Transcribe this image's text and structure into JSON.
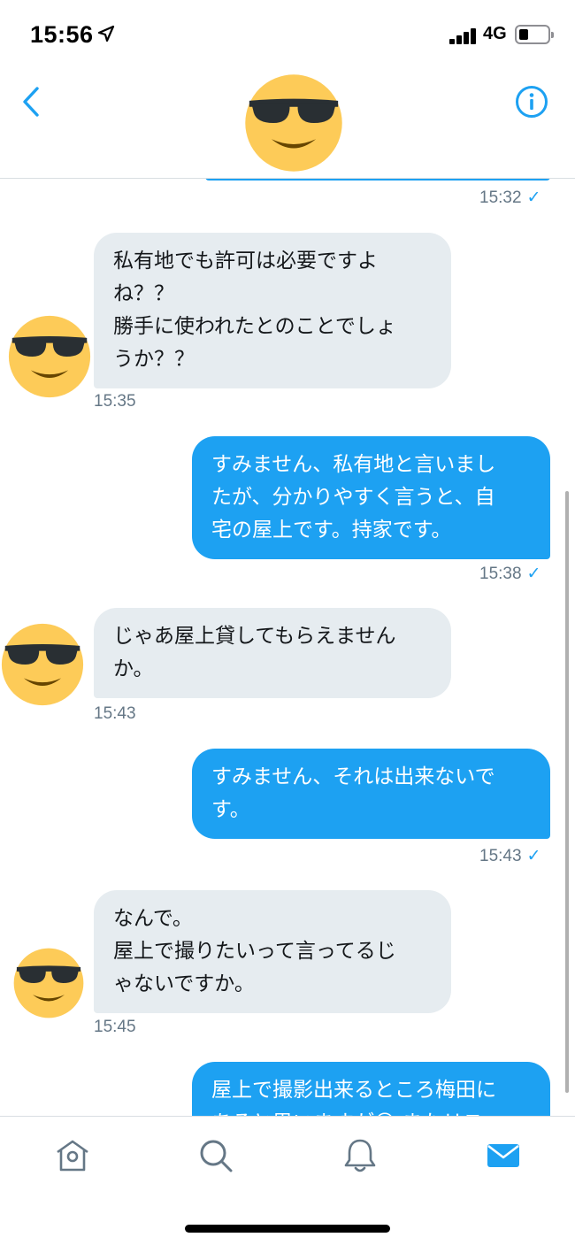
{
  "status_bar": {
    "time": "15:56",
    "network": "4G"
  },
  "header": {
    "back_icon": "chevron-left-icon",
    "info_icon": "info-circle-icon",
    "avatar_icon": "sunglasses-smiley-icon"
  },
  "messages": [
    {
      "direction": "out",
      "lines": [],
      "time": "15:32",
      "read": true
    },
    {
      "direction": "in",
      "lines": [
        "私有地でも許可は必要ですよ",
        "ね？？",
        "勝手に使われたとのことでしょ",
        "うか？？"
      ],
      "time": "15:35"
    },
    {
      "direction": "out",
      "lines": [
        "すみません、私有地と言いまし",
        "たが、分かりやすく言うと、自",
        "宅の屋上です。持家です。"
      ],
      "time": "15:38",
      "read": true
    },
    {
      "direction": "in",
      "lines": [
        "じゃあ屋上貸してもらえません",
        "か。"
      ],
      "time": "15:43"
    },
    {
      "direction": "out",
      "lines": [
        "すみません、それは出来ないで",
        "す。"
      ],
      "time": "15:43",
      "read": true
    },
    {
      "direction": "in",
      "lines": [
        "なんで。",
        "屋上で撮りたいって言ってるじ",
        "ゃないですか。"
      ],
      "time": "15:45"
    },
    {
      "direction": "out",
      "lines": [
        "屋上で撮影出来るところ梅田に",
        "あると思いますが😅 またリス"
      ],
      "time": ""
    }
  ],
  "read_mark": "✓",
  "tabs": [
    {
      "name": "home",
      "icon": "home-icon",
      "active": false
    },
    {
      "name": "search",
      "icon": "search-icon",
      "active": false
    },
    {
      "name": "notifications",
      "icon": "bell-icon",
      "active": false
    },
    {
      "name": "messages",
      "icon": "mail-icon",
      "active": true
    }
  ],
  "colors": {
    "accent": "#1da1f2",
    "incoming_bubble": "#e6ecf0",
    "timestamp": "#657786",
    "tab_inactive": "#657786"
  }
}
